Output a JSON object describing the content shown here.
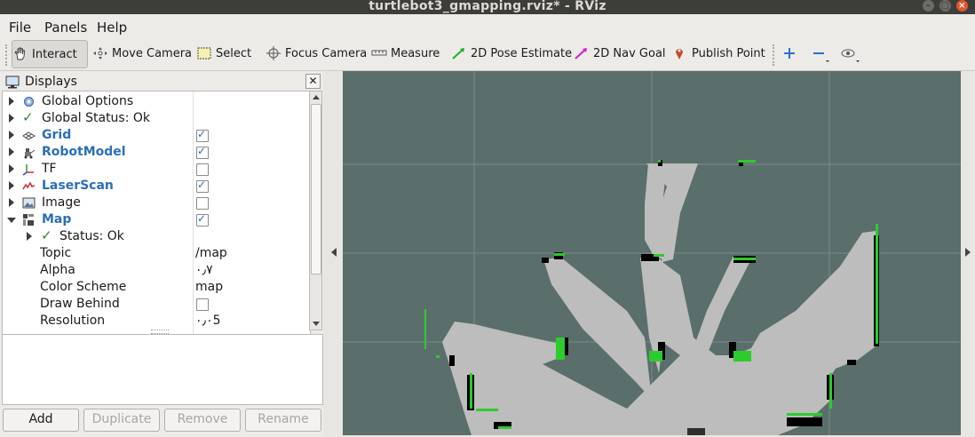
{
  "window": {
    "title": "turtlebot3_gmapping.rviz* - RViz"
  },
  "menu": {
    "file": "File",
    "panels": "Panels",
    "help": "Help"
  },
  "toolbar": {
    "interact": "Interact",
    "move_camera": "Move Camera",
    "select": "Select",
    "focus_camera": "Focus Camera",
    "measure": "Measure",
    "pose_estimate": "2D Pose Estimate",
    "nav_goal": "2D Nav Goal",
    "publish_point": "Publish Point"
  },
  "displays": {
    "title": "Displays",
    "rows": [
      {
        "label": "Global Options"
      },
      {
        "label": "Global Status: Ok"
      },
      {
        "label": "Grid",
        "checked": true
      },
      {
        "label": "RobotModel",
        "checked": true
      },
      {
        "label": "TF",
        "checked": false
      },
      {
        "label": "LaserScan",
        "checked": true
      },
      {
        "label": "Image",
        "checked": false
      },
      {
        "label": "Map",
        "checked": true
      },
      {
        "label": "Status: Ok"
      },
      {
        "label": "Topic",
        "value": "/map"
      },
      {
        "label": "Alpha",
        "value": "٠٫٧"
      },
      {
        "label": "Color Scheme",
        "value": "map"
      },
      {
        "label": "Draw Behind",
        "checked": false
      },
      {
        "label": "Resolution",
        "value": "٠٫٠5"
      }
    ],
    "buttons": {
      "add": "Add",
      "duplicate": "Duplicate",
      "remove": "Remove",
      "rename": "Rename"
    }
  },
  "colors": {
    "view_background": "#5a6e6b",
    "map_free": "#bdbdbd",
    "map_occupied": "#000000",
    "laser": "#2ccc2c",
    "grid": "#9aa9a6"
  }
}
